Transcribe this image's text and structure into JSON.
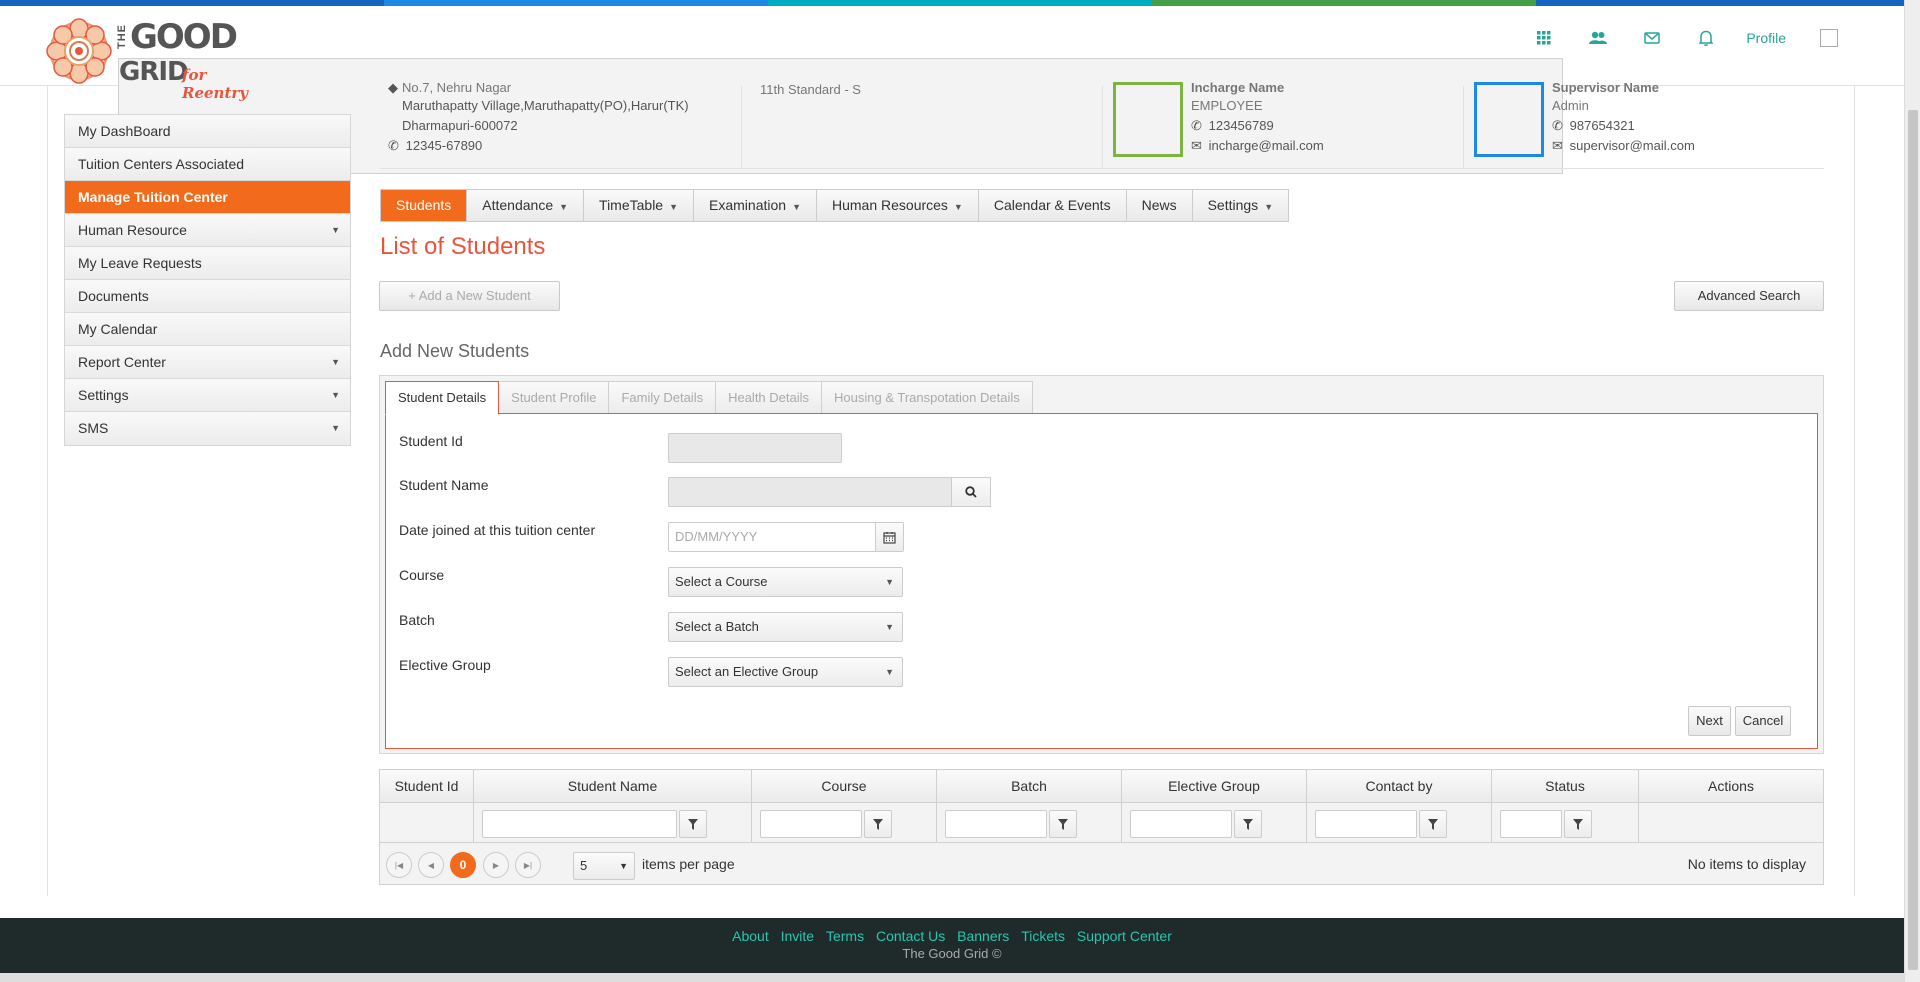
{
  "brand": {
    "line1": "THE",
    "line2": "GOOD",
    "line3": "GRID",
    "tagline": "for Reentry"
  },
  "header": {
    "icons": [
      "apps-grid-icon",
      "users-icon",
      "mail-icon",
      "bell-icon"
    ],
    "profile_label": "Profile"
  },
  "sidebar": {
    "items": [
      {
        "label": "My DashBoard",
        "has_submenu": false
      },
      {
        "label": "Tuition Centers Associated",
        "has_submenu": false
      },
      {
        "label": "Manage Tuition Center",
        "has_submenu": false,
        "active": true
      },
      {
        "label": "Human Resource",
        "has_submenu": true
      },
      {
        "label": "My Leave Requests",
        "has_submenu": false
      },
      {
        "label": "Documents",
        "has_submenu": false
      },
      {
        "label": "My Calendar",
        "has_submenu": false
      },
      {
        "label": "Report Center",
        "has_submenu": true
      },
      {
        "label": "Settings",
        "has_submenu": true
      },
      {
        "label": "SMS",
        "has_submenu": true
      }
    ]
  },
  "info": {
    "address_line1": "No.7, Nehru Nagar",
    "address_line2": "Maruthapatty Village,Maruthapatty(PO),Harur(TK)",
    "address_line3": "Dharmapuri-600072",
    "phone": "12345-67890",
    "standard": "11th Standard - S",
    "incharge": {
      "name": "Incharge Name",
      "role": "EMPLOYEE",
      "phone": "123456789",
      "email": "incharge@mail.com"
    },
    "supervisor": {
      "name": "Supervisor Name",
      "role": "Admin",
      "phone": "987654321",
      "email": "supervisor@mail.com"
    }
  },
  "menubar": {
    "items": [
      {
        "label": "Students",
        "dropdown": false,
        "active": true
      },
      {
        "label": "Attendance",
        "dropdown": true
      },
      {
        "label": "TimeTable",
        "dropdown": true
      },
      {
        "label": "Examination",
        "dropdown": true
      },
      {
        "label": "Human Resources",
        "dropdown": true
      },
      {
        "label": "Calendar & Events",
        "dropdown": false
      },
      {
        "label": "News",
        "dropdown": false
      },
      {
        "label": "Settings",
        "dropdown": true
      }
    ]
  },
  "page": {
    "title": "List of Students",
    "add_button": "Add a New Student",
    "advanced_search": "Advanced Search",
    "section_title": "Add New Students"
  },
  "form": {
    "tabs": [
      "Student Details",
      "Student Profile",
      "Family Details",
      "Health Details",
      "Housing & Transpotation Details"
    ],
    "active_tab": "Student Details",
    "student_id_label": "Student Id",
    "student_name_label": "Student Name",
    "date_joined_label": "Date joined at this tuition center",
    "date_placeholder": "DD/MM/YYYY",
    "course_label": "Course",
    "course_value": "Select a Course",
    "batch_label": "Batch",
    "batch_value": "Select a Batch",
    "elective_label": "Elective Group",
    "elective_value": "Select an Elective Group",
    "next_label": "Next",
    "cancel_label": "Cancel"
  },
  "grid": {
    "columns": [
      "Student Id",
      "Student Name",
      "Course",
      "Batch",
      "Elective Group",
      "Contact by",
      "Status",
      "Actions"
    ],
    "current_page": "0",
    "page_size": "5",
    "items_per_page_label": "items per page",
    "empty_message": "No items to display"
  },
  "footer": {
    "links": [
      "About",
      "Invite",
      "Terms",
      "Contact Us",
      "Banners",
      "Tickets",
      "Support Center"
    ],
    "copyright": "The Good Grid ©"
  },
  "colors": {
    "accent": "#f26a1b",
    "title": "#e8553d",
    "link": "#26a69a",
    "footer_bg": "#1f2a2a"
  }
}
